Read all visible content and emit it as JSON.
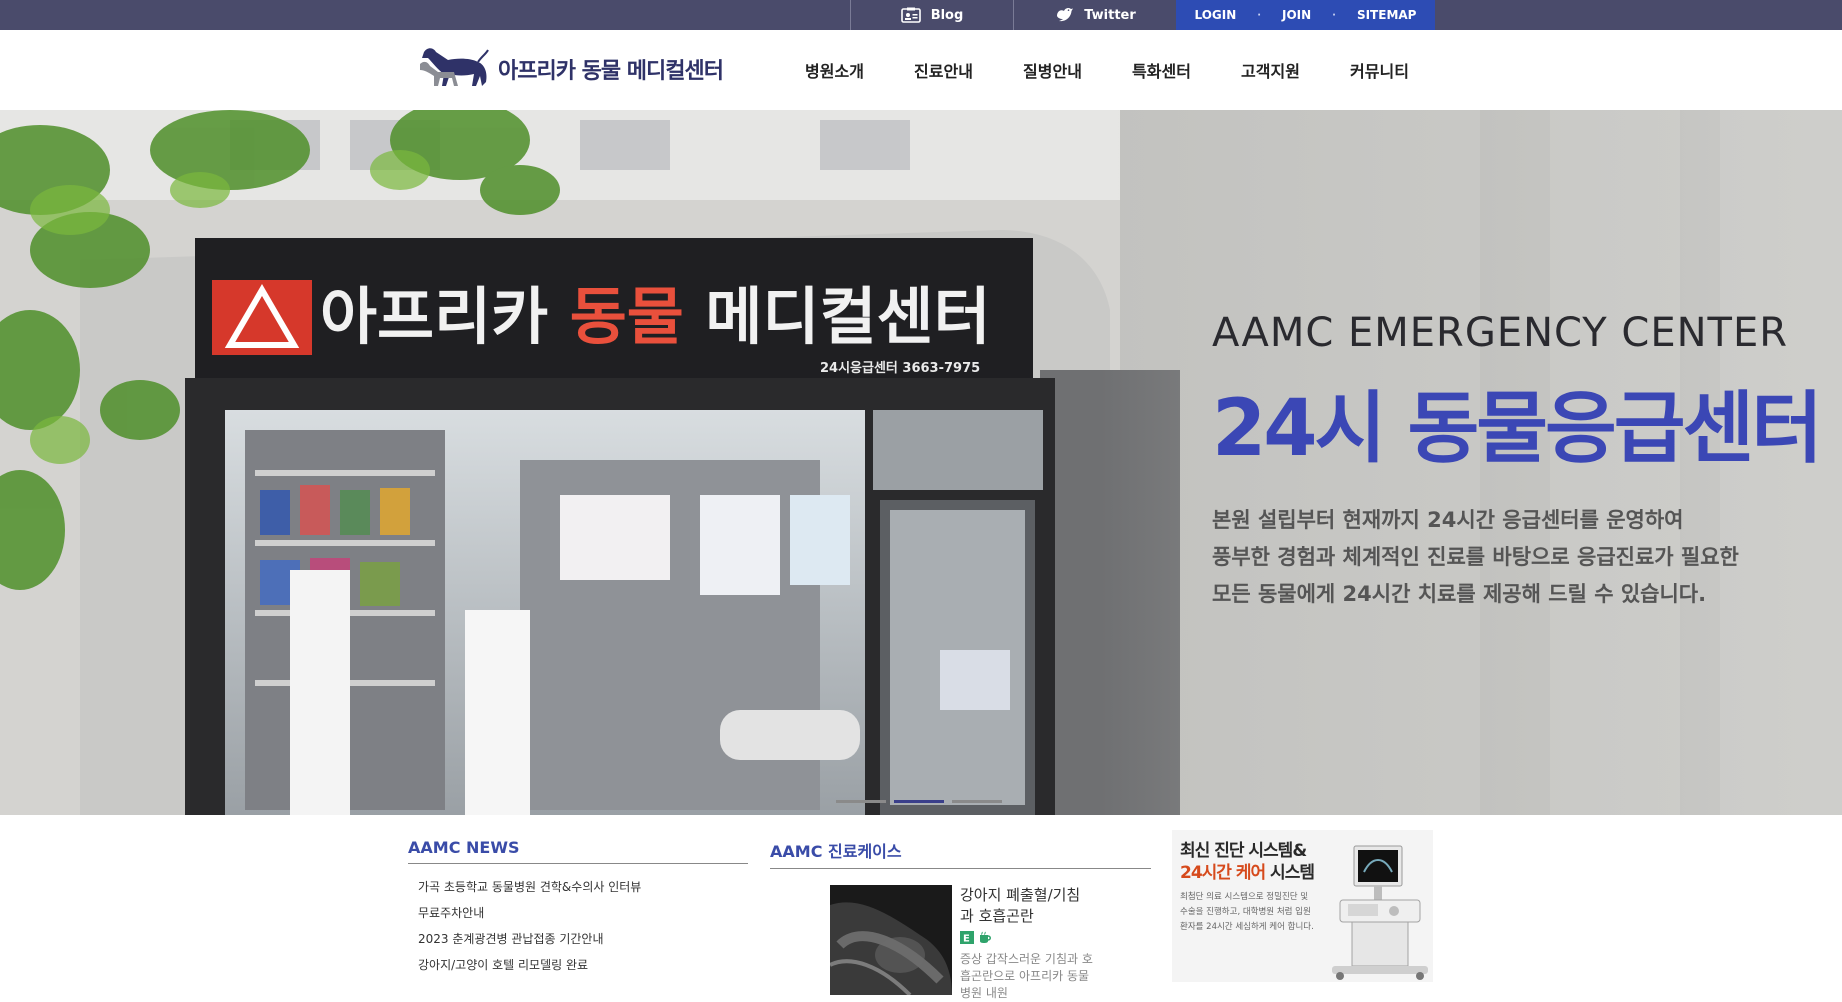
{
  "topbar": {
    "blog_label": "Blog",
    "twitter_label": "Twitter",
    "login_label": "LOGIN",
    "join_label": "JOIN",
    "sitemap_label": "SITEMAP",
    "separator": "·",
    "icons": {
      "blog": "id-card-icon",
      "twitter": "bird-icon"
    }
  },
  "header": {
    "logo_text": "아프리카 동물 메디컬센터",
    "nav": [
      "병원소개",
      "진료안내",
      "질병안내",
      "특화센터",
      "고객지원",
      "커뮤니티"
    ]
  },
  "hero": {
    "eyebrow": "AAMC EMERGENCY CENTER",
    "title": "24시 동물응급센터",
    "description": [
      "본원 설립부터 현재까지 24시간 응급센터를 운영하여",
      "풍부한 경험과 체계적인 진료를 바탕으로 응급진료가 필요한",
      "모든 동물에게 24시간 치료를 제공해 드릴 수 있습니다."
    ],
    "storefront_sign": "아프리카 동물 메디컬센터",
    "storefront_phone": "24시응급센터 3663-7975",
    "slides_total": 3,
    "slide_active": 2
  },
  "news": {
    "title": "AAMC NEWS",
    "items": [
      "가곡 초등학교 동물병원 견학&수의사 인터뷰",
      "무료주차안내",
      "2023 춘계광견병 관납접종 기간안내",
      "강아지/고양이 호텔 리모델링 완료"
    ]
  },
  "cases": {
    "title": "AAMC 진료케이스",
    "item": {
      "title": "강아지 폐출혈/기침과 호흡곤란",
      "description": "증상 갑작스러운 기침과 호흡곤란으로 아프리카 동물병원 내원",
      "badges": [
        "e-badge-icon",
        "cup-icon"
      ]
    }
  },
  "promo": {
    "headline_part1": "최신 진단 시스템&",
    "headline_accent": "24시간 케어",
    "headline_part2": " 시스템",
    "text": "최첨단 의료 시스템으로 정밀진단 및 수술을 진행하고, 대학병원 처럼 입원환자를 24시간 세심하게 케어 합니다.",
    "image": "ultrasound-machine-icon"
  },
  "colors": {
    "topbar_bg": "#4a4b6b",
    "auth_bg": "#2d4cb4",
    "accent_blue": "#3b47b5",
    "accent_orange": "#d64a1c"
  }
}
